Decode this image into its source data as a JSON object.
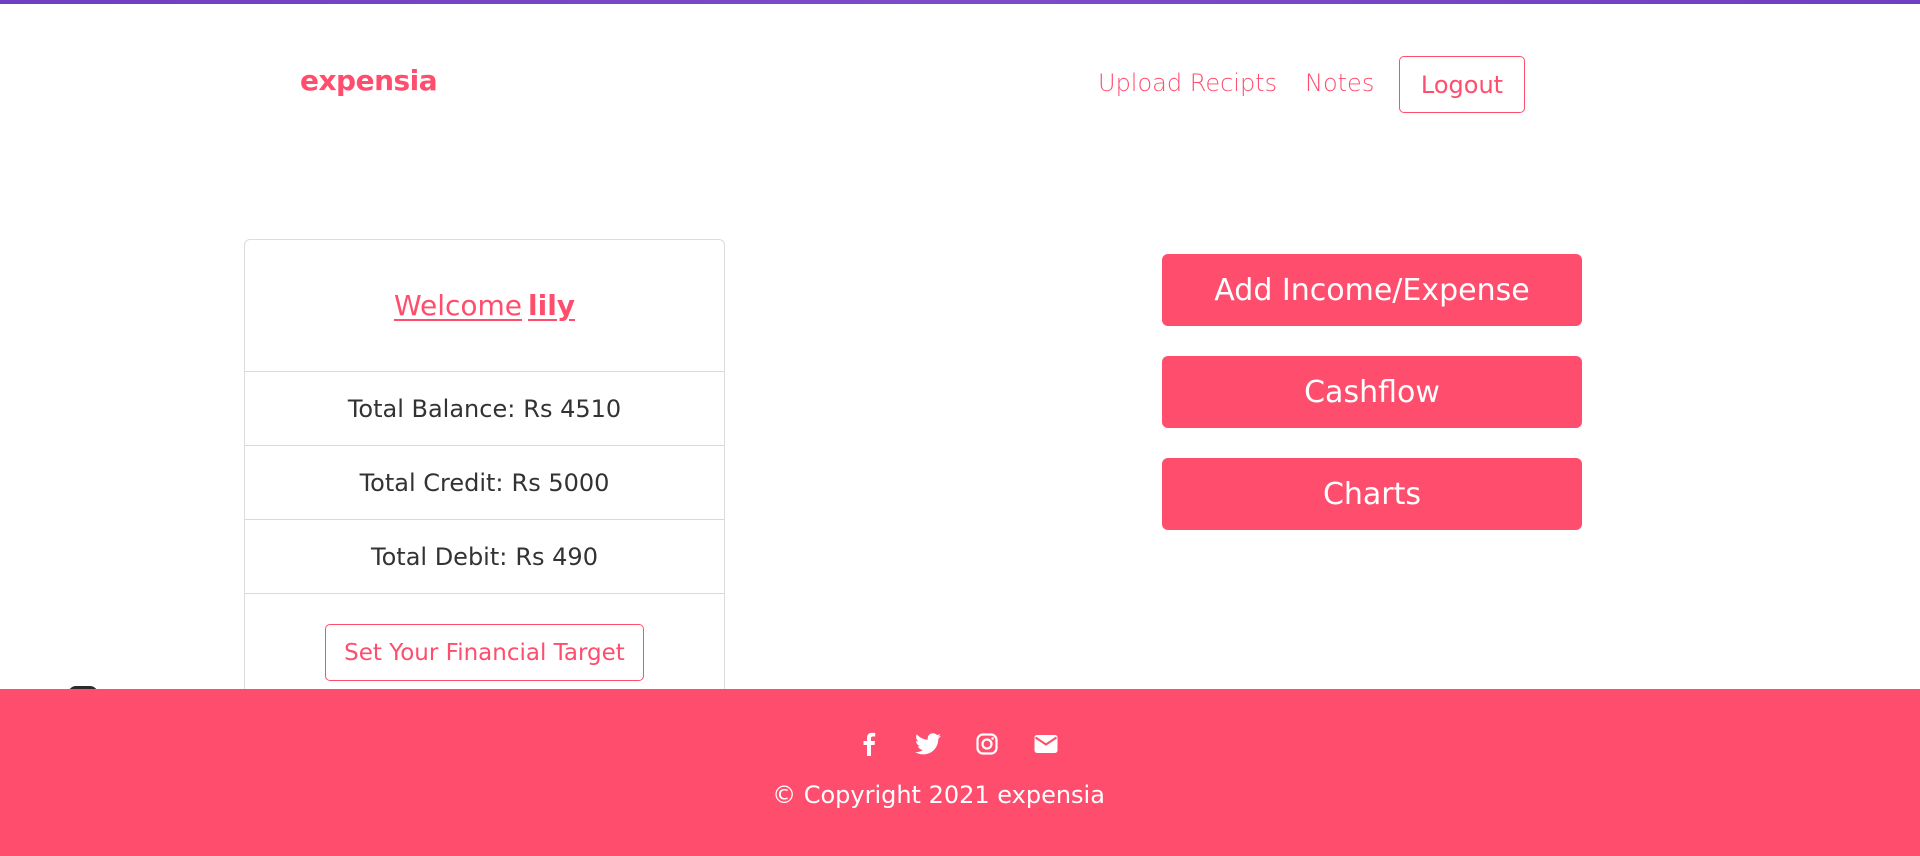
{
  "header": {
    "brand": "expensia",
    "nav": {
      "upload": "Upload Recipts",
      "notes": "Notes",
      "logout": "Logout"
    }
  },
  "card": {
    "welcome_prefix": "Welcome",
    "username": "lily",
    "balance_label": "Total Balance:",
    "balance_value": "Rs 4510",
    "credit_label": "Total Credit:",
    "credit_value": "Rs 5000",
    "debit_label": "Total Debit:",
    "debit_value": "Rs 490",
    "target_button": "Set Your Financial Target"
  },
  "actions": {
    "add": "Add Income/Expense",
    "cashflow": "Cashflow",
    "charts": "Charts"
  },
  "footer": {
    "social_icons": [
      "facebook-icon",
      "twitter-icon",
      "instagram-icon",
      "envelope-icon"
    ],
    "copyright": "© Copyright 2021 expensia"
  },
  "colors": {
    "accent": "#ff4d6d",
    "top_bar": "#6f3fc1"
  }
}
